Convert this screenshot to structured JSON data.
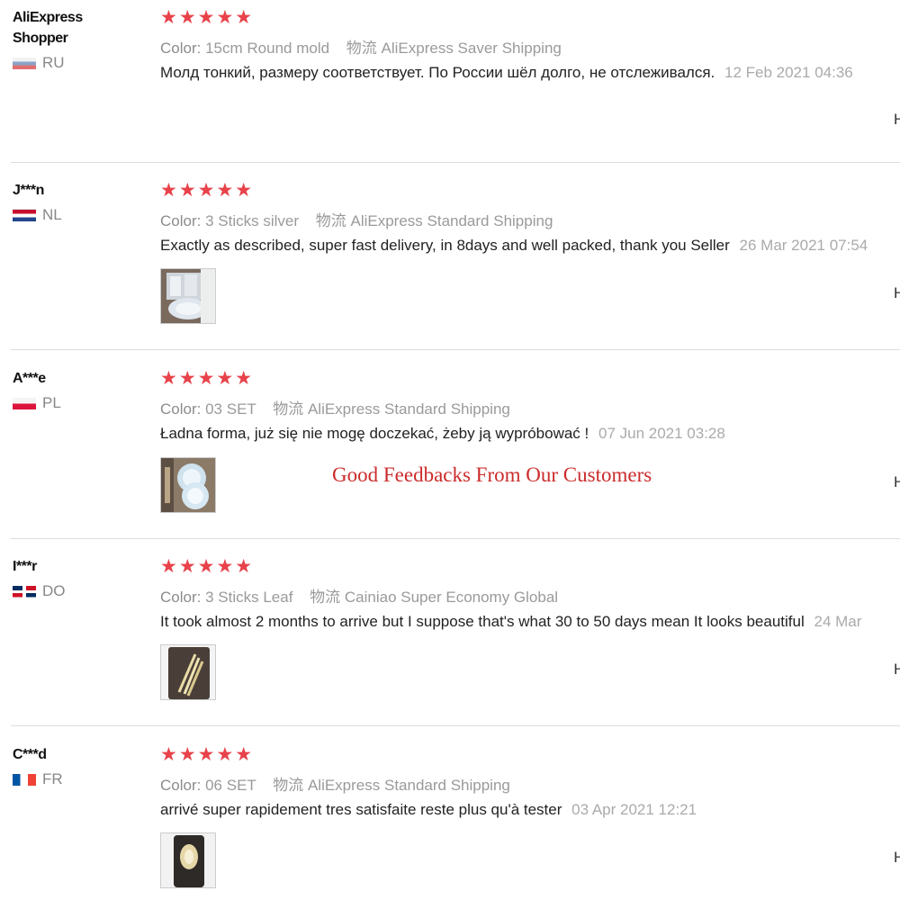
{
  "labels": {
    "color_label": "Color:",
    "shipping_prefix": "物流",
    "edge_char": "H"
  },
  "banner": "Good Feedbacks From Our Customers",
  "colors": {
    "star": "#e8424a",
    "banner": "#cc2b2b",
    "muted": "#9a9a9a"
  },
  "reviews": [
    {
      "username": "AliExpress Shopper",
      "country": "RU",
      "stars": "★★★★★",
      "color": "15cm Round mold",
      "shipping": "AliExpress Saver Shipping",
      "text": "Молд тонкий, размеру соответствует. По России шёл долго, не отслеживался.",
      "date": "12 Feb 2021 04:36",
      "has_photo": false
    },
    {
      "username": "J***n",
      "country": "NL",
      "stars": "★★★★★",
      "color": "3 Sticks silver",
      "shipping": "AliExpress Standard Shipping",
      "text": "Exactly as described, super fast delivery, in 8days and well packed, thank you Seller",
      "date": "26 Mar 2021 07:54",
      "has_photo": true
    },
    {
      "username": "A***e",
      "country": "PL",
      "stars": "★★★★★",
      "color": "03 SET",
      "shipping": "AliExpress Standard Shipping",
      "text": "Ładna forma, już się nie mogę doczekać, żeby ją wypróbować !",
      "date": "07 Jun 2021 03:28",
      "has_photo": true
    },
    {
      "username": "I***r",
      "country": "DO",
      "stars": "★★★★★",
      "color": "3 Sticks Leaf",
      "shipping": "Cainiao Super Economy Global",
      "text": "It took almost 2 months to arrive but I suppose that's what 30 to 50 days mean It looks beautiful",
      "date": "24 Mar",
      "has_photo": true
    },
    {
      "username": "C***d",
      "country": "FR",
      "stars": "★★★★★",
      "color": "06 SET",
      "shipping": "AliExpress Standard Shipping",
      "text": "arrivé super rapidement tres satisfaite reste plus qu'à tester",
      "date": "03 Apr 2021 12:21",
      "has_photo": true
    }
  ]
}
